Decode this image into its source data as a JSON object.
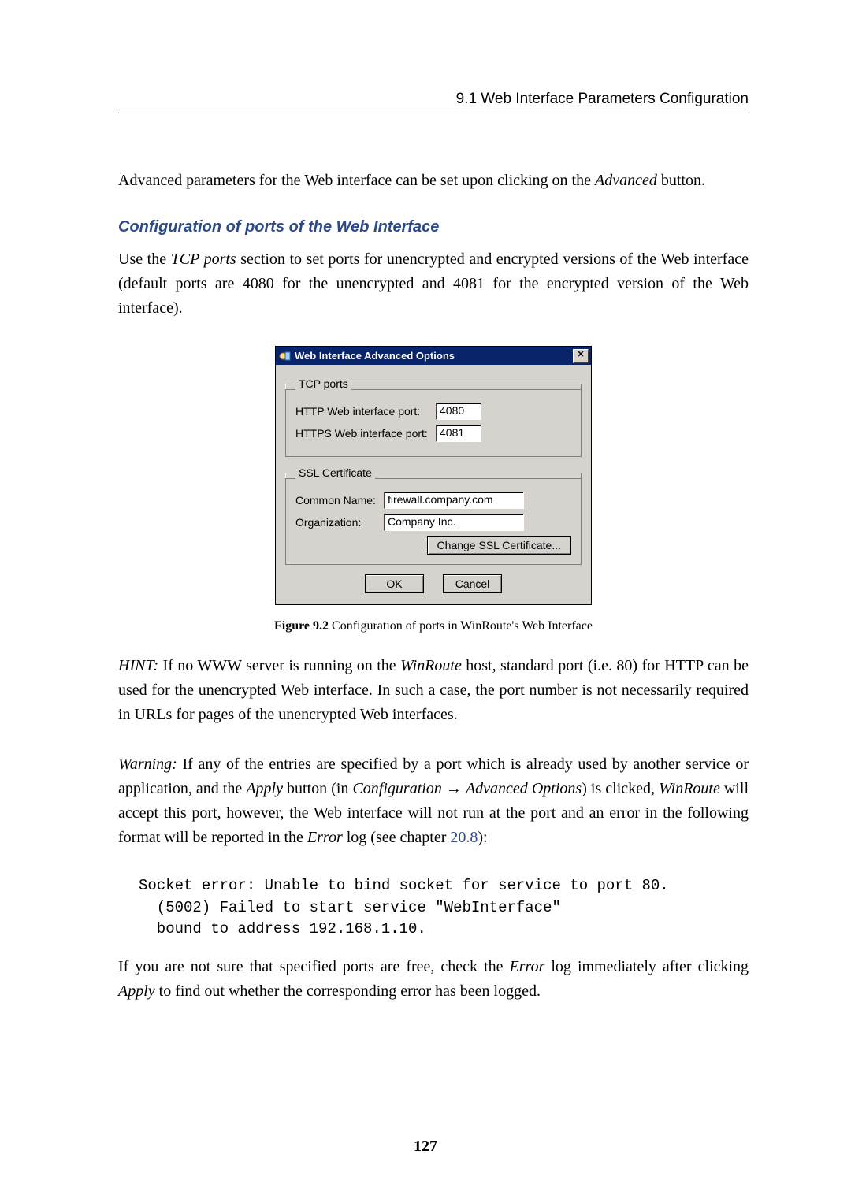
{
  "header": {
    "running": "9.1  Web Interface Parameters Configuration"
  },
  "para1_a": "Advanced parameters for the Web interface can be set upon clicking on the ",
  "para1_ital": "Advanced",
  "para1_b": " button.",
  "subheading": "Configuration of ports of the Web Interface",
  "para2_a": "Use the ",
  "para2_ital": "TCP ports",
  "para2_b": " section to set ports for unencrypted and encrypted versions of the Web interface (default ports are 4080 for the unencrypted and 4081 for the encrypted version of the Web interface).",
  "dialog": {
    "title": "Web Interface Advanced Options",
    "tcp_legend": "TCP ports",
    "http_label": "HTTP Web interface port:",
    "http_value": "4080",
    "https_label": "HTTPS Web interface port:",
    "https_value": "4081",
    "ssl_legend": "SSL Certificate",
    "common_name_label": "Common Name:",
    "common_name_value": "firewall.company.com",
    "organization_label": "Organization:",
    "organization_value": "Company Inc.",
    "change_cert": "Change SSL Certificate...",
    "ok": "OK",
    "cancel": "Cancel"
  },
  "figure_caption": {
    "label": "Figure 9.2",
    "text": "   Configuration of ports in WinRoute's Web Interface"
  },
  "hint": {
    "lead": "HINT:",
    "a": " If no WWW server is running on the ",
    "winroute": "WinRoute",
    "b": " host, standard port (i.e. 80) for HTTP can be used for the unencrypted Web interface. In such a case, the port number is not necessarily required in URLs for pages of the unencrypted Web interfaces."
  },
  "warning": {
    "lead": "Warning:",
    "a": " If any of the entries are specified by a port which is already used by another service or application, and the ",
    "apply": "Apply",
    "b": " button (in ",
    "conf": "Configuration",
    "arrow": " → ",
    "adv": "Advanced Options",
    "c": ") is clicked, ",
    "winroute": "WinRoute",
    "d": " will accept this port, however, the Web interface will not run at the port and an error in the following format will be reported in the ",
    "error": "Error",
    "e": " log (see chapter ",
    "link": "20.8",
    "f": "):"
  },
  "code": "Socket error: Unable to bind socket for service to port 80.\n  (5002) Failed to start service \"WebInterface\"\n  bound to address 192.168.1.10.",
  "tail": {
    "a": "If you are not sure that specified ports are free, check the ",
    "error": "Error",
    "b": " log immediately after clicking ",
    "apply": "Apply",
    "c": " to find out whether the corresponding error has been logged."
  },
  "page_number": "127"
}
